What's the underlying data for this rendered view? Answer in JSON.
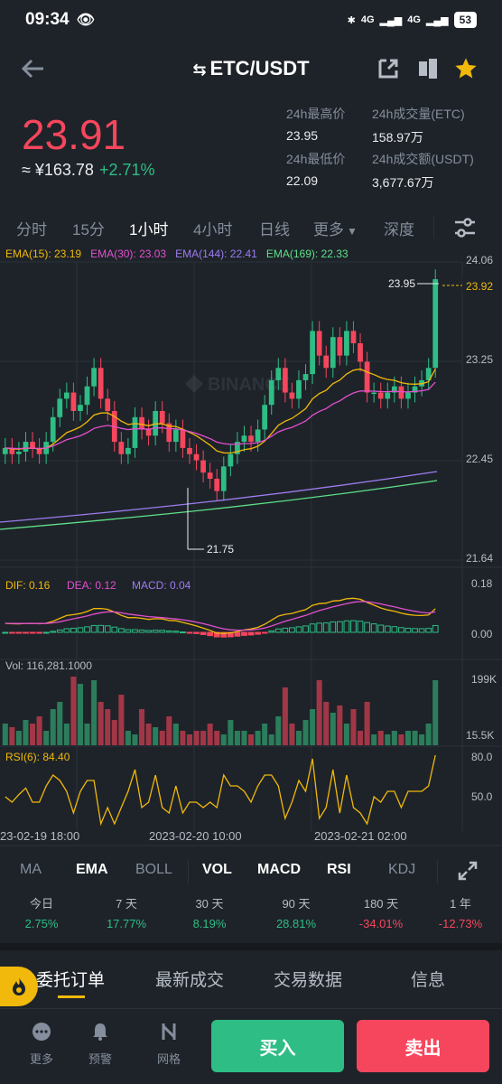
{
  "status": {
    "time": "09:34",
    "battery": "53",
    "net1": "4G",
    "net2": "4G"
  },
  "nav": {
    "pair": "ETC/USDT"
  },
  "price": {
    "last": "23.91",
    "cny": "≈ ¥163.78",
    "change": "+2.71%",
    "high_label": "24h最高价",
    "high": "23.95",
    "low_label": "24h最低价",
    "low": "22.09",
    "vol_label": "24h成交量(ETC)",
    "vol": "158.97万",
    "amt_label": "24h成交额(USDT)",
    "amt": "3,677.67万"
  },
  "timeframes": {
    "t1": "分时",
    "t2": "15分",
    "t3": "1小时",
    "t4": "4小时",
    "t5": "日线",
    "t6": "更多",
    "t7": "深度"
  },
  "ema_legend": {
    "e15": "EMA(15): 23.19",
    "e30": "EMA(30): 23.03",
    "e144": "EMA(144): 22.41",
    "e169": "EMA(169): 22.33"
  },
  "chart_data": {
    "type": "candlestick",
    "price_axis": [
      "24.06",
      "23.25",
      "22.45",
      "21.64"
    ],
    "price_ylim": [
      21.64,
      24.06
    ],
    "current_price_tag": "23.92",
    "high_marker": "23.95",
    "low_marker": "21.75",
    "watermark": "BINANCE",
    "macd_legend": {
      "dif": "DIF: 0.16",
      "dea": "DEA: 0.12",
      "macd": "MACD: 0.04"
    },
    "macd_axis": [
      "0.18",
      "0.00"
    ],
    "vol_legend": "Vol: 116,281.1000",
    "vol_axis": [
      "199K",
      "15.5K"
    ],
    "rsi_legend": "RSI(6): 84.40",
    "rsi_axis": [
      "80.0",
      "50.0"
    ],
    "x_labels": [
      "23-02-19 18:00",
      "2023-02-20 10:00",
      "2023-02-21 02:00"
    ]
  },
  "indicators": {
    "ma": "MA",
    "ema": "EMA",
    "boll": "BOLL",
    "vol": "VOL",
    "macd": "MACD",
    "rsi": "RSI",
    "kdj": "KDJ"
  },
  "performance": [
    {
      "label": "今日",
      "value": "2.75%",
      "up": true
    },
    {
      "label": "7 天",
      "value": "17.77%",
      "up": true
    },
    {
      "label": "30 天",
      "value": "8.19%",
      "up": true
    },
    {
      "label": "90 天",
      "value": "28.81%",
      "up": true
    },
    {
      "label": "180 天",
      "value": "-34.01%",
      "up": false
    },
    {
      "label": "1 年",
      "value": "-12.73%",
      "up": false
    }
  ],
  "tabs": {
    "orders": "委托订单",
    "trades": "最新成交",
    "data": "交易数据",
    "info": "信息"
  },
  "bottom": {
    "more": "更多",
    "alert": "预警",
    "grid": "网格",
    "buy": "买入",
    "sell": "卖出"
  },
  "colors": {
    "up": "#2ebd85",
    "down": "#f6465d",
    "accent": "#f0b90b",
    "bg": "#1e2329"
  }
}
